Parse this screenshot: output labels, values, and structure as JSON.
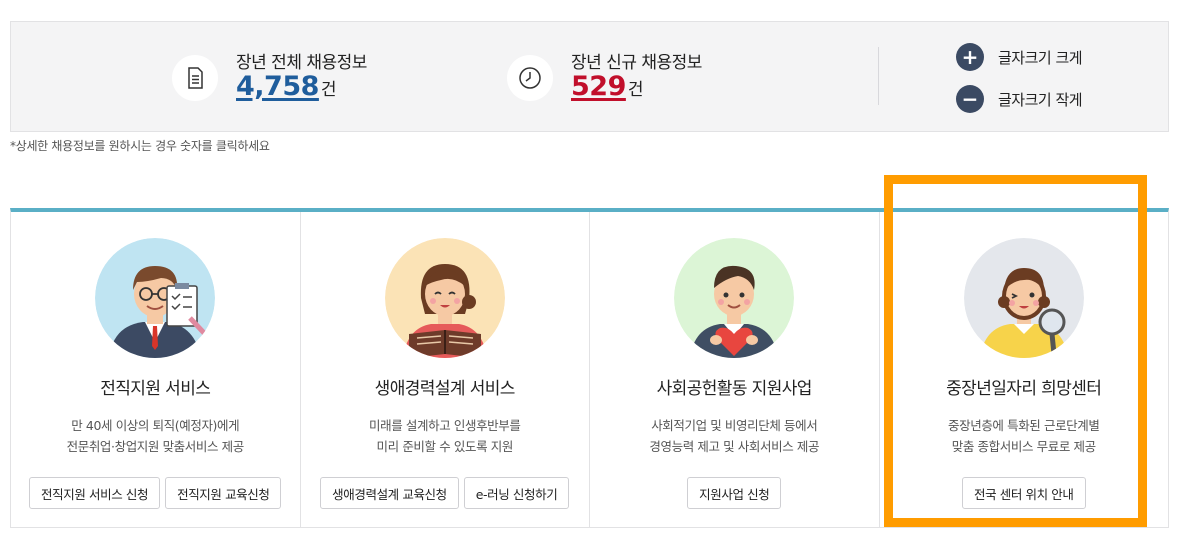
{
  "stats": {
    "total": {
      "label": "장년 전체 채용정보",
      "value": "4,758",
      "unit": "건",
      "icon": "document-icon"
    },
    "new": {
      "label": "장년 신규 채용정보",
      "value": "529",
      "unit": "건",
      "icon": "clock-icon"
    }
  },
  "font_controls": {
    "increase": {
      "symbol": "+",
      "label": "글자크기 크게"
    },
    "decrease": {
      "symbol": "−",
      "label": "글자크기 작게"
    }
  },
  "notice": "*상세한 채용정보를 원하시는 경우 숫자를 클릭하세요",
  "cards": [
    {
      "title": "전직지원 서비스",
      "desc": [
        "만 40세 이상의 퇴직(예정자)에게",
        "전문취업·창업지원 맞춤서비스 제공"
      ],
      "buttons": [
        "전직지원 서비스 신청",
        "전직지원 교육신청"
      ]
    },
    {
      "title": "생애경력설계 서비스",
      "desc": [
        "미래를 설계하고 인생후반부를",
        "미리 준비할 수 있도록 지원"
      ],
      "buttons": [
        "생애경력설계 교육신청",
        "e-러닝 신청하기"
      ]
    },
    {
      "title": "사회공헌활동 지원사업",
      "desc": [
        "사회적기업 및 비영리단체 등에서",
        "경영능력 제고 및 사회서비스 제공"
      ],
      "buttons": [
        "지원사업 신청"
      ]
    },
    {
      "title": "중장년일자리 희망센터",
      "desc": [
        "중장년층에 특화된 근로단계별",
        "맞춤 종합서비스 무료로 제공"
      ],
      "buttons": [
        "전국 센터 위치 안내"
      ]
    }
  ],
  "colors": {
    "accent_bar": "#5aafc6",
    "total_value": "#1f5d9c",
    "new_value": "#c10f2b",
    "font_button": "#3b4a63",
    "highlight": "#ff9c00"
  }
}
